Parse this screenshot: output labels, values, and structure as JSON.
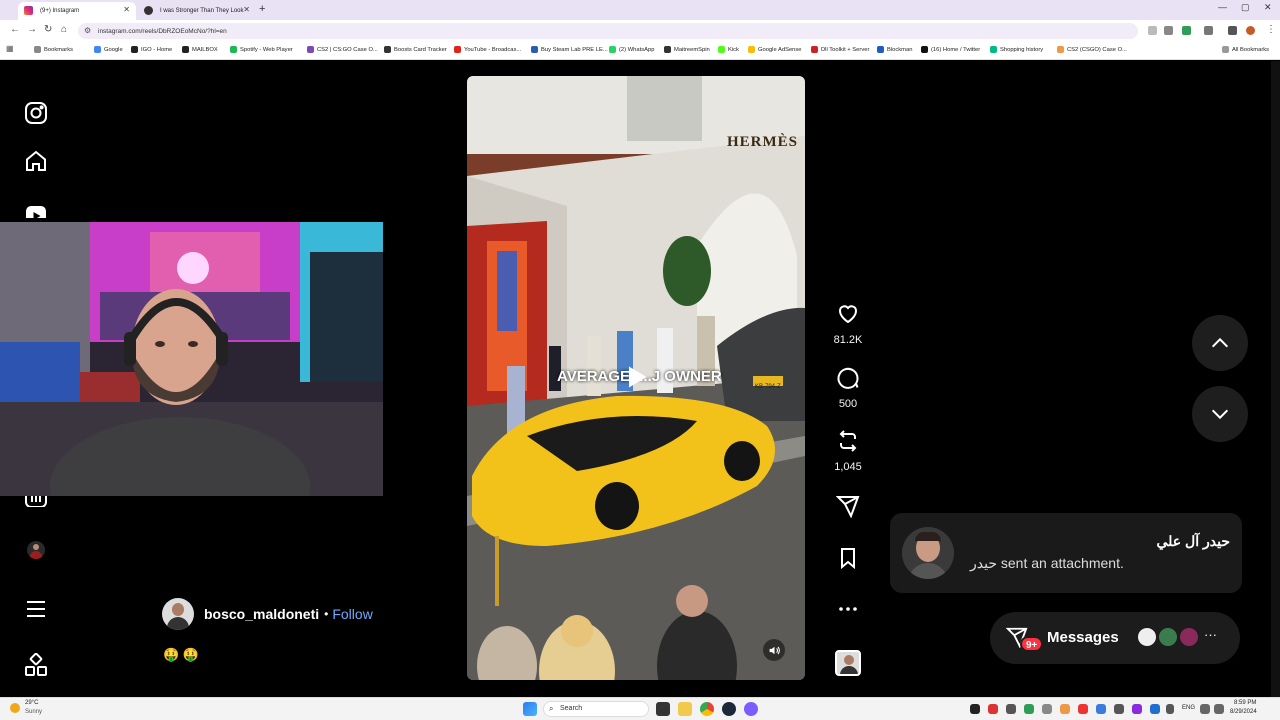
{
  "browser": {
    "tabs": [
      {
        "title": "(9+) Instagram",
        "active": true
      },
      {
        "title": "I was Stronger Than They Look",
        "active": false
      }
    ],
    "url": "instagram.com/reels/DbRZOEoMcNo/?hl=en",
    "bookmarks": [
      "Bookmarks",
      "Google",
      "IGO - Home",
      "MAILBOX",
      "Spotify - Web Player",
      "CS2 | CS:GO Case O...",
      "Boosts Card Tracker",
      "YouTube - Broadcas...",
      "Buy Steam Lab PRE LE...",
      "(2) WhatsApp",
      "MaitreemSpin",
      "Kick",
      "Google AdSense",
      "Dll Toolkit + Server",
      "Blockman",
      "(16) Home / Twitter",
      "Shopping history",
      "CS2 (CSGO) Case O..."
    ],
    "all_bookmarks": "All Bookmarks"
  },
  "reel": {
    "overlay_text": "AVERAGE: ...J OWNER",
    "store_sign": "HERMÈS",
    "plate_text": "KB-794-Z"
  },
  "actions": {
    "likes": "81.2K",
    "comments": "500",
    "reposts": "1,045"
  },
  "author": {
    "username": "bosco_maldoneti",
    "separator": "•",
    "follow": "Follow",
    "caption_emoji": "🤑 🤑"
  },
  "notification": {
    "name": "حيدر آل علي",
    "message": "حيدر sent an attachment."
  },
  "messages": {
    "label": "Messages",
    "badge": "9+",
    "more": "···"
  },
  "taskbar": {
    "weather_temp": "29°C",
    "weather_desc": "Sunny",
    "search": "Search",
    "lang": "ENG",
    "time": "8:59 PM",
    "date": "8/29/2024"
  },
  "colors": {
    "follow": "#6fa8ff",
    "badge": "#ff3040",
    "lambo": "#f2c21b"
  }
}
